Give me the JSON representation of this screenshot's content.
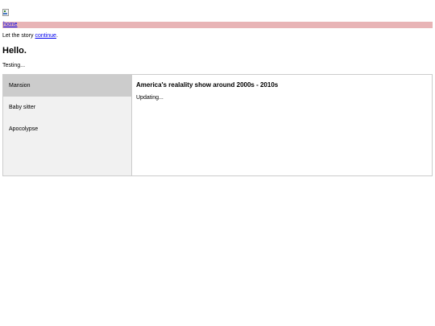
{
  "header": {
    "image_icon": "broken-image-icon"
  },
  "nav": {
    "home_link": "home",
    "background": "#e8b4b6"
  },
  "intro": {
    "text_before": "Let the story ",
    "link": "continue",
    "text_after": "."
  },
  "heading": "Hello.",
  "status": "Testing...",
  "tabs": {
    "items": [
      {
        "label": "Mansion",
        "active": true
      },
      {
        "label": "Baby sitter",
        "active": false
      },
      {
        "label": "Apocolypse",
        "active": false
      }
    ],
    "content": {
      "title": "America's realality show around 2000s - 2010s",
      "text": "Updating..."
    },
    "colors": {
      "active_tab": "#cccccc",
      "tab_list": "#f1f1f1",
      "border": "#cccccc"
    }
  }
}
